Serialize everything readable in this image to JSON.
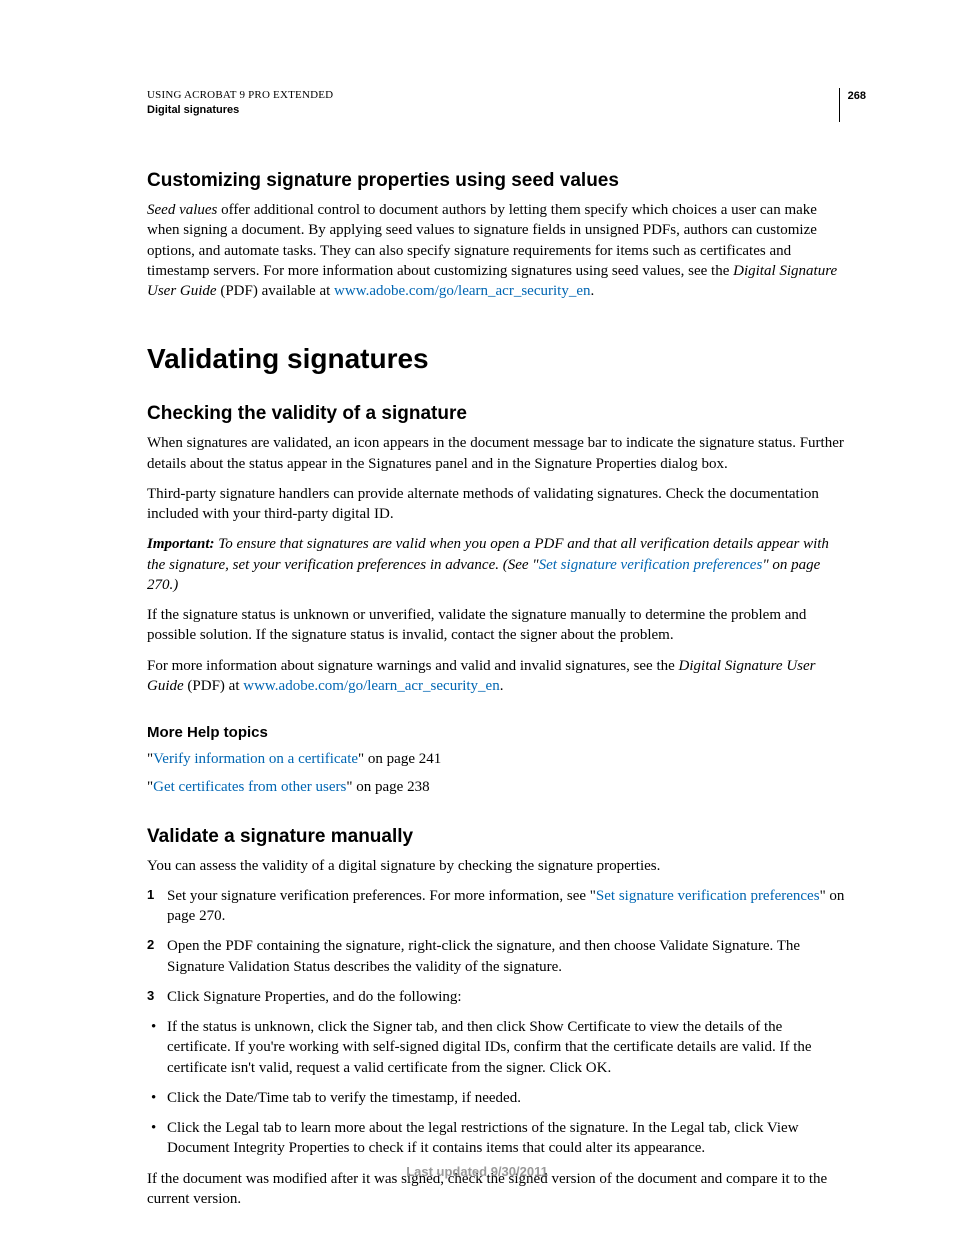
{
  "header": {
    "title": "USING ACROBAT 9 PRO EXTENDED",
    "subtitle": "Digital signatures",
    "page_number": "268"
  },
  "section1": {
    "heading": "Customizing signature properties using seed values",
    "p1_a": "Seed values",
    "p1_b": " offer additional control to document authors by letting them specify which choices a user can make when signing a document. By applying seed values to signature fields in unsigned PDFs, authors can customize options, and automate tasks. They can also specify signature requirements for items such as certificates and timestamp servers. For more information about customizing signatures using seed values, see the ",
    "p1_c": "Digital Signature User Guide",
    "p1_d": " (PDF) available at ",
    "link1": "www.adobe.com/go/learn_acr_security_en",
    "p1_e": "."
  },
  "chapter": {
    "heading": "Validating signatures"
  },
  "section2": {
    "heading": "Checking the validity of a signature",
    "p1": "When signatures are validated, an icon appears in the document message bar to indicate the signature status. Further details about the status appear in the Signatures panel and in the Signature Properties dialog box.",
    "p2": "Third-party signature handlers can provide alternate methods of validating signatures. Check the documentation included with your third-party digital ID.",
    "p3_a": "Important:",
    "p3_b": " To ensure that signatures are valid when you open a PDF and that all verification details appear with the signature, set your verification preferences in advance. (See \"",
    "p3_link": "Set signature verification preferences",
    "p3_c": "\" on page 270.)",
    "p4": "If the signature status is unknown or unverified, validate the signature manually to determine the problem and possible solution. If the signature status is invalid, contact the signer about the problem.",
    "p5_a": "For more information about signature warnings and valid and invalid signatures, see the ",
    "p5_b": "Digital Signature User Guide",
    "p5_c": " (PDF) at ",
    "p5_link": "www.adobe.com/go/learn_acr_security_en",
    "p5_d": "."
  },
  "more_help": {
    "heading": "More Help topics",
    "t1_a": "\"",
    "t1_link": "Verify information on a certificate",
    "t1_b": "\" on page 241",
    "t2_a": "\"",
    "t2_link": "Get certificates from other users",
    "t2_b": "\" on page 238"
  },
  "section3": {
    "heading": "Validate a signature manually",
    "intro": "You can assess the validity of a digital signature by checking the signature properties.",
    "step1_a": "Set your signature verification preferences. For more information, see \"",
    "step1_link": "Set signature verification preferences",
    "step1_b": "\" on page 270.",
    "step2": "Open the PDF containing the signature, right-click the signature, and then choose Validate Signature. The Signature Validation Status describes the validity of the signature.",
    "step3": "Click Signature Properties, and do the following:",
    "b1": "If the status is unknown, click the Signer tab, and then click Show Certificate to view the details of the certificate. If you're working with self-signed digital IDs, confirm that the certificate details are valid. If the certificate isn't valid, request a valid certificate from the signer. Click OK.",
    "b2": "Click the Date/Time tab to verify the timestamp, if needed.",
    "b3": "Click the Legal tab to learn more about the legal restrictions of the signature. In the Legal tab, click View Document Integrity Properties to check if it contains items that could alter its appearance.",
    "outro": "If the document was modified after it was signed, check the signed version of the document and compare it to the current version."
  },
  "footer": {
    "text": "Last updated 9/30/2011"
  },
  "nums": {
    "n1": "1",
    "n2": "2",
    "n3": "3"
  }
}
